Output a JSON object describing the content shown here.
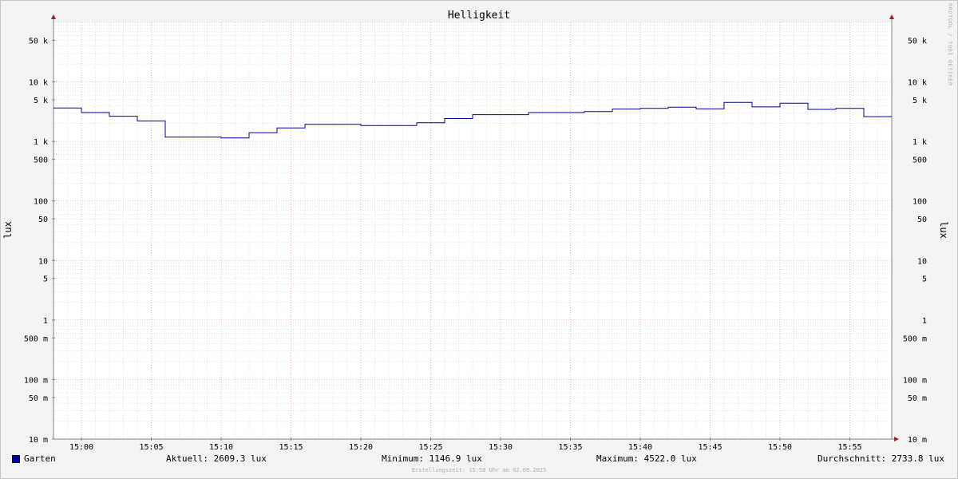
{
  "chart_data": {
    "type": "line",
    "title": "Helligkeit",
    "ylabel_left": "lux",
    "ylabel_right": "lux",
    "y_scale": "log",
    "ylim": [
      0.01,
      100000
    ],
    "y_ticks": [
      {
        "v": 50000,
        "label": "50 k"
      },
      {
        "v": 10000,
        "label": "10 k"
      },
      {
        "v": 5000,
        "label": "5 k"
      },
      {
        "v": 1000,
        "label": "1 k"
      },
      {
        "v": 500,
        "label": "500"
      },
      {
        "v": 100,
        "label": "100"
      },
      {
        "v": 50,
        "label": "50"
      },
      {
        "v": 10,
        "label": "10"
      },
      {
        "v": 5,
        "label": "5"
      },
      {
        "v": 1,
        "label": "1"
      },
      {
        "v": 0.5,
        "label": "500 m"
      },
      {
        "v": 0.1,
        "label": "100 m"
      },
      {
        "v": 0.05,
        "label": "50 m"
      },
      {
        "v": 0.01,
        "label": "10 m"
      }
    ],
    "xlim": [
      "14:58",
      "15:58"
    ],
    "x_ticks": [
      "15:00",
      "15:05",
      "15:10",
      "15:15",
      "15:20",
      "15:25",
      "15:30",
      "15:35",
      "15:40",
      "15:45",
      "15:50",
      "15:55"
    ],
    "grid": true,
    "series": [
      {
        "name": "Garten",
        "color": "#0000a0",
        "step": true,
        "points": [
          {
            "t": "14:58",
            "v": 3650
          },
          {
            "t": "15:00",
            "v": 3050
          },
          {
            "t": "15:02",
            "v": 2650
          },
          {
            "t": "15:04",
            "v": 2200
          },
          {
            "t": "15:06",
            "v": 1180
          },
          {
            "t": "15:10",
            "v": 1147
          },
          {
            "t": "15:12",
            "v": 1400
          },
          {
            "t": "15:14",
            "v": 1680
          },
          {
            "t": "15:16",
            "v": 1930
          },
          {
            "t": "15:20",
            "v": 1850
          },
          {
            "t": "15:24",
            "v": 2060
          },
          {
            "t": "15:26",
            "v": 2420
          },
          {
            "t": "15:28",
            "v": 2820
          },
          {
            "t": "15:32",
            "v": 3050
          },
          {
            "t": "15:36",
            "v": 3180
          },
          {
            "t": "15:38",
            "v": 3500
          },
          {
            "t": "15:40",
            "v": 3600
          },
          {
            "t": "15:42",
            "v": 3750
          },
          {
            "t": "15:44",
            "v": 3520
          },
          {
            "t": "15:46",
            "v": 4522
          },
          {
            "t": "15:48",
            "v": 3800
          },
          {
            "t": "15:50",
            "v": 4380
          },
          {
            "t": "15:52",
            "v": 3450
          },
          {
            "t": "15:54",
            "v": 3600
          },
          {
            "t": "15:56",
            "v": 2609.3
          },
          {
            "t": "15:58",
            "v": 2609.3
          }
        ]
      }
    ]
  },
  "legend": {
    "series_name": "Garten",
    "current": "Aktuell: 2609.3 lux",
    "minimum": "Minimum: 1146.9 lux",
    "maximum": "Maximum: 4522.0 lux",
    "average": "Durchschnitt: 2733.8 lux"
  },
  "footer": "Erstellungszeit: 15:58 Uhr am 02.08.2025",
  "vendor": "RRDTOOL / TOBI OETIKER",
  "colors": {
    "series": "#0000a0",
    "major_grid": "#e8a0a0",
    "minor_grid": "#c8c8c8",
    "axis": "#808080",
    "arrow": "#a02020"
  }
}
